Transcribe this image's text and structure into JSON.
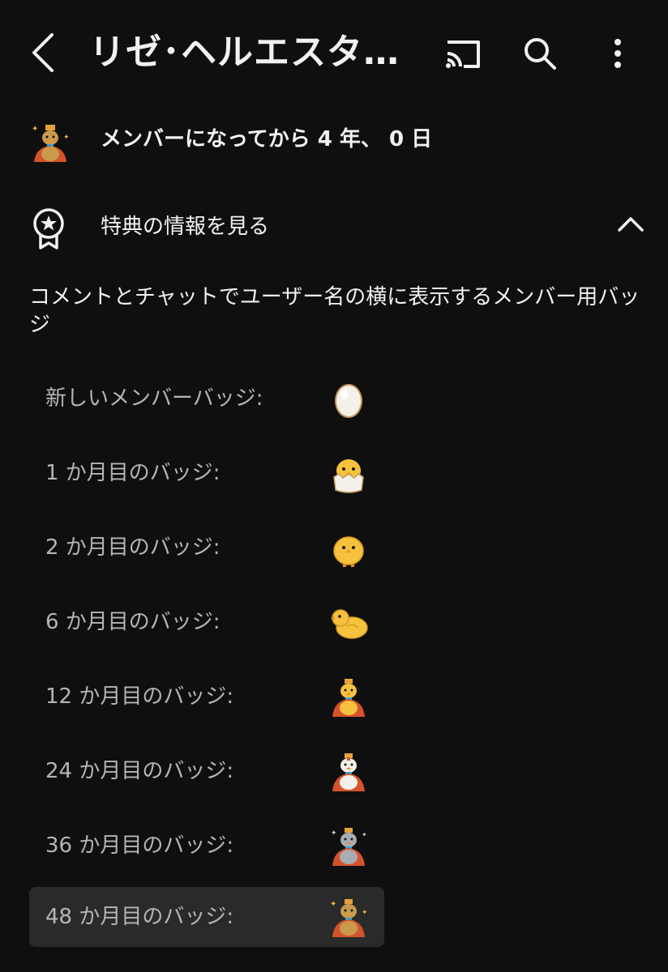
{
  "header": {
    "title": "リゼ･ヘルエスタ…",
    "icons": [
      "back-icon",
      "cast-icon",
      "search-icon",
      "more-vert-icon"
    ]
  },
  "membership": {
    "duration_text": "メンバーになってから 4 年、 0 日"
  },
  "perks": {
    "label": "特典の情報を見る",
    "expanded": true
  },
  "badges_section": {
    "description": "コメントとチャットでユーザー名の横に表示するメンバー用バッジ",
    "items": [
      {
        "label": "新しいメンバーバッジ:",
        "badge": "egg",
        "selected": false
      },
      {
        "label": "1 か月目のバッジ:",
        "badge": "hatching-chick",
        "selected": false
      },
      {
        "label": "2 か月目のバッジ:",
        "badge": "chick",
        "selected": false
      },
      {
        "label": "6 か月目のバッジ:",
        "badge": "duck",
        "selected": false
      },
      {
        "label": "12 か月目のバッジ:",
        "badge": "crowned-chick-yellow",
        "selected": false
      },
      {
        "label": "24 か月目のバッジ:",
        "badge": "crowned-chicken-white",
        "selected": false
      },
      {
        "label": "36 か月目のバッジ:",
        "badge": "crowned-chicken-silver",
        "selected": false
      },
      {
        "label": "48 か月目のバッジ:",
        "badge": "crowned-chicken-gold",
        "selected": true
      }
    ]
  },
  "colors": {
    "background": "#0f0f0f",
    "text_primary": "#f1f1f1",
    "text_secondary": "#b5b5b5",
    "selected_row": "#2a2a2a"
  }
}
